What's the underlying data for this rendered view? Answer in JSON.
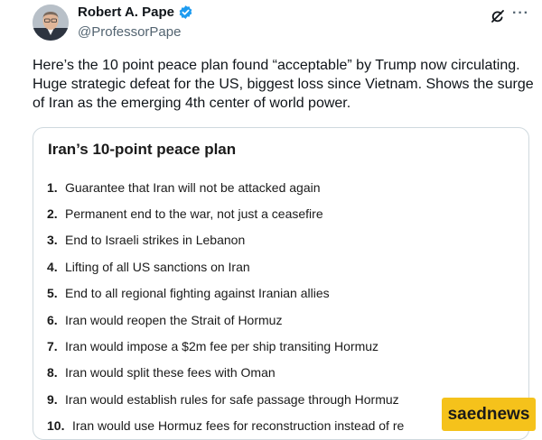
{
  "author": {
    "name": "Robert A. Pape",
    "handle": "@ProfessorPape"
  },
  "post": {
    "text": "Here’s the 10 point peace plan found “acceptable” by Trump now circulating.  Huge strategic defeat for the US, biggest loss since Vietnam. Shows the surge of Iran as the emerging 4th center of world power."
  },
  "card": {
    "title": "Iran’s 10-point peace plan",
    "items": [
      {
        "num": "1.",
        "text": "Guarantee that Iran will not be attacked again"
      },
      {
        "num": "2.",
        "text": "Permanent end to the war, not just a ceasefire"
      },
      {
        "num": "3.",
        "text": "End to Israeli strikes in Lebanon"
      },
      {
        "num": "4.",
        "text": "Lifting of all US sanctions on Iran"
      },
      {
        "num": "5.",
        "text": "End to all regional fighting against Iranian allies"
      },
      {
        "num": "6.",
        "text": "Iran would reopen the Strait of Hormuz"
      },
      {
        "num": "7.",
        "text": "Iran would impose a $2m fee per ship transiting Hormuz"
      },
      {
        "num": "8.",
        "text": "Iran would split these fees with Oman"
      },
      {
        "num": "9.",
        "text": "Iran would establish rules for safe passage through Hormuz"
      },
      {
        "num": "10.",
        "text": "Iran would use Hormuz fees for reconstruction instead of re"
      }
    ]
  },
  "watermark": {
    "text": "saednews"
  },
  "icons": {
    "verified": "verified-badge-icon",
    "grok": "grok-icon",
    "more": "more-options-icon"
  },
  "colors": {
    "verified": "#1d9bf0",
    "secondary_text": "#536471",
    "card_border": "#cfd9de",
    "watermark_bg": "#f5c21b"
  }
}
